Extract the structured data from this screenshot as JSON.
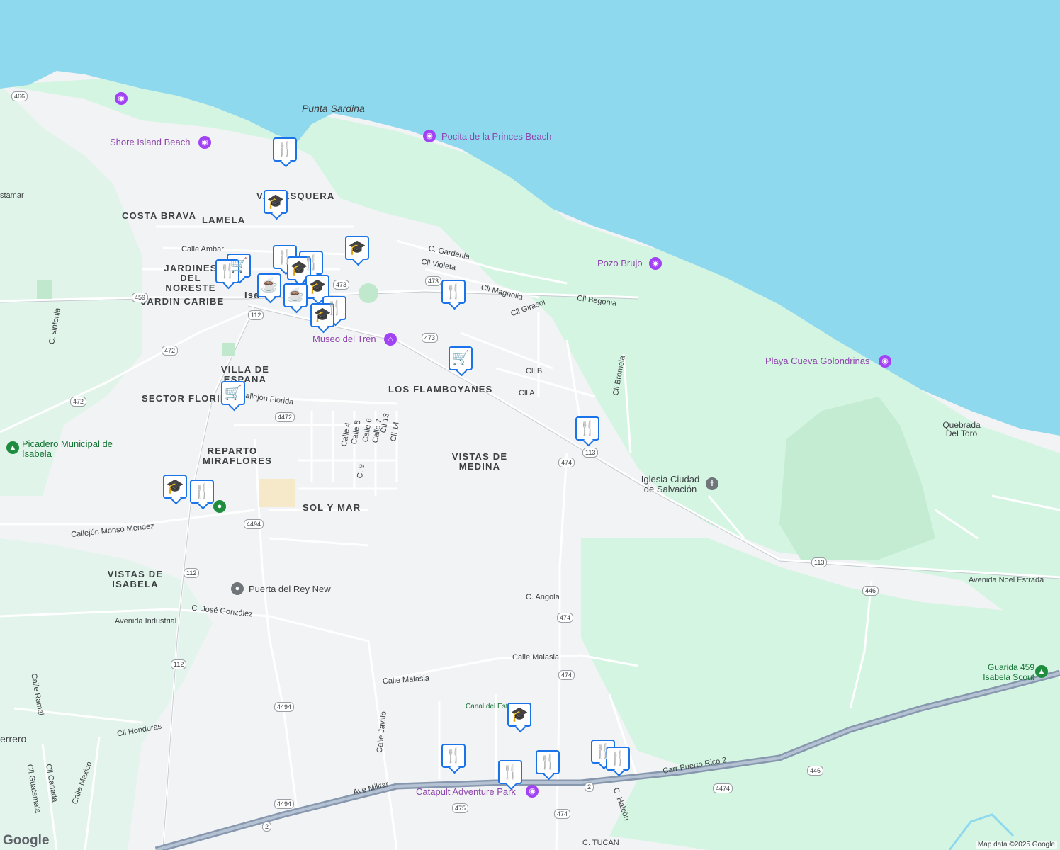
{
  "map": {
    "colors": {
      "ocean": "#8fd9ee",
      "land": "#f1f3f4",
      "park": "#d5f5e3",
      "road": "#ffffff",
      "road_edge": "#c7cbd0",
      "highway": "#8797ad",
      "pin_border": "#1a73e8"
    },
    "coastal_labels": {
      "punta_sardina": "Punta Sardina",
      "shore_island_beach": "Shore Island Beach",
      "pocita_beach": "Pocita de la Princes Beach",
      "pozo_brujo": "Pozo Brujo",
      "playa_cueva": "Playa Cueva Golondrinas",
      "quebrada": "Quebrada Del Toro"
    },
    "neighborhoods": {
      "costa_brava": "COSTA BRAVA",
      "lamela": "LAMELA",
      "jardines": "JARDINES DEL NORESTE",
      "jardin_caribe": "JARDIN CARIBE",
      "villa_espana": "VILLA DE ESPANA",
      "sector_florida": "SECTOR FLORIDA",
      "flamboyanes": "LOS FLAMBOYANES",
      "vistas_medina": "VISTAS DE MEDINA",
      "reparto": "REPARTO MIRAFLORES",
      "sol_y_mar": "SOL Y MAR",
      "vistas_isabela": "VISTAS DE ISABELA",
      "pesquera": "V... PESQUERA",
      "isabela_partial": "Isa",
      "guerrero_partial": "errero",
      "costamar_partial": "stamar"
    },
    "streets": {
      "calle_ambar": "Calle Ambar",
      "c_gardenia": "C. Gardenia",
      "cll_violeta": "Cll Violeta",
      "cll_magnolia": "Cll Magnolia",
      "cll_girasol": "Cll Girasol",
      "cll_begonia": "Cll Begonia",
      "cll_bromela": "Cll Bromela",
      "cll_b": "Cll B",
      "cll_a": "Cll A",
      "callejon_florida": "Callejón Florida",
      "calle_4": "Calle 4",
      "calle_5": "Calle 5",
      "calle_6": "Calle 6",
      "calle_7": "Calle 7",
      "cll_13": "Cll 13",
      "cll_14": "Cll 14",
      "c_9": "C. 9",
      "callejon_monso": "Callejón Monso Mendez",
      "c_angola": "C. Angola",
      "avenida_industrial": "Avenida Industrial",
      "c_jose": "C. José González",
      "calle_malasia_1": "Calle Malasia",
      "calle_malasia_2": "Calle Malasia",
      "calle_javillo": "Calle Javillo",
      "cll_honduras": "Cll Honduras",
      "calle_ramal": "Calle Ramal",
      "cll_canada": "Cll Canada",
      "cll_guatemala": "Cll Guatemala",
      "calle_mexico": "Calle Mexico",
      "ave_militar": "Ave Militar",
      "carr_pr2": "Carr Puerto Rico 2",
      "c_halcon": "C. Halcón",
      "c_tucan": "C. TUCAN",
      "avenida_noel": "Avenida Noel Estrada",
      "c_sinfonia": "C. sinfonia"
    },
    "places": {
      "museo": "Museo del Tren",
      "iglesia": "Iglesia Ciudad de Salvación",
      "picadero": "Picadero Municipal de Isabela",
      "puerta": "Puerta del Rey New",
      "guarida": "Guarida 459 Isabela Scout",
      "canal": "Canal del Este",
      "catapult": "Catapult Adventure Park"
    },
    "shields": [
      "466",
      "459",
      "112",
      "472",
      "473",
      "473",
      "473",
      "4472",
      "474",
      "113",
      "4494",
      "112",
      "474",
      "474",
      "4494",
      "112",
      "2",
      "2",
      "446",
      "4474",
      "475",
      "474",
      "113",
      "446",
      "4494",
      "472"
    ],
    "attribution": "Map data ©2025 Google",
    "logo": "Google"
  }
}
